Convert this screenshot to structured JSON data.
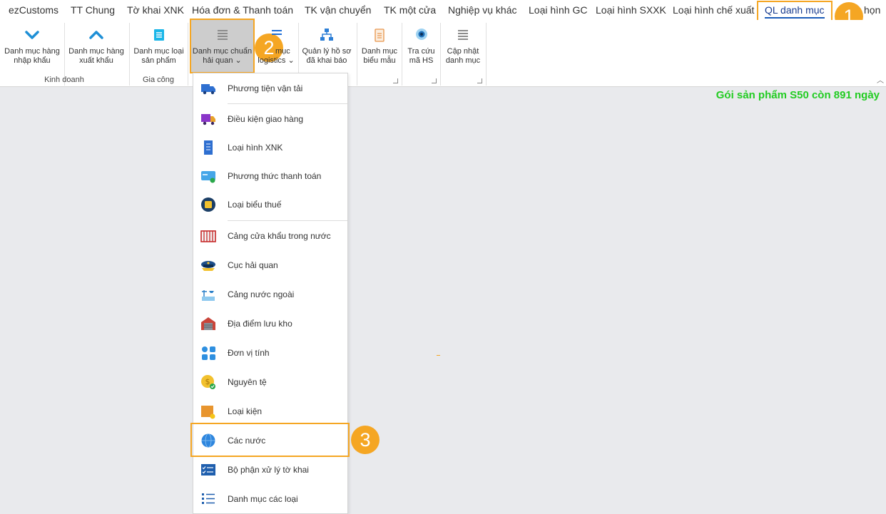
{
  "tabs": [
    {
      "label": "ezCustoms"
    },
    {
      "label": "TT Chung"
    },
    {
      "label": "Tờ khai XNK"
    },
    {
      "label": "Hóa đơn & Thanh toán"
    },
    {
      "label": "TK vận chuyển"
    },
    {
      "label": "TK một cửa"
    },
    {
      "label": "Nghiệp vụ khác"
    },
    {
      "label": "Loại hình GC"
    },
    {
      "label": "Loại hình SXXK"
    },
    {
      "label": "Loại hình chế xuất"
    },
    {
      "label": "QL danh mục"
    },
    {
      "label": "Tùy chọn",
      "visible_fragment": "họn"
    }
  ],
  "active_tab": "QL danh mục",
  "ribbon": {
    "buttons": [
      {
        "line1": "Danh mục hàng",
        "line2": "nhập khẩu",
        "icon": "chevron-down-icon"
      },
      {
        "line1": "Danh mục hàng",
        "line2": "xuất khẩu",
        "icon": "chevron-up-icon"
      },
      {
        "line1": "Danh mục loại",
        "line2": "sản phẩm",
        "icon": "list-icon"
      },
      {
        "line1": "Danh mục chuẩn",
        "line2": "hải quan",
        "icon": "lines-icon",
        "has_dropdown": true,
        "selected": true
      },
      {
        "line1": "Danh mục",
        "line2": "logistics",
        "visible_line1": "mục",
        "icon": "list-icon",
        "has_dropdown": true
      },
      {
        "line1": "Quản lý hồ sơ",
        "line2": "đã khai báo",
        "icon": "sitemap-icon"
      },
      {
        "line1": "Danh mục",
        "line2": "biểu mẫu",
        "icon": "clipboard-icon"
      },
      {
        "line1": "Tra cứu",
        "line2": "mã HS",
        "icon": "eye-icon"
      },
      {
        "line1": "Cập nhật",
        "line2": "danh mục",
        "icon": "lines-icon"
      }
    ],
    "groups": [
      {
        "label": "Kinh doanh"
      },
      {
        "label": "Gia công"
      }
    ]
  },
  "status_text": "Gói sản phẩm S50 còn 891 ngày",
  "dropdown": {
    "items": [
      {
        "label": "Phương tiện vận tải",
        "icon": "truck-icon"
      },
      {
        "label": "Điều kiện giao hàng",
        "icon": "delivery-truck-icon"
      },
      {
        "label": "Loại hình XNK",
        "icon": "document-icon"
      },
      {
        "label": "Phương thức thanh toán",
        "icon": "credit-card-icon"
      },
      {
        "label": "Loại biểu thuế",
        "icon": "tax-icon"
      },
      {
        "label": "Cảng cửa khẩu trong nước",
        "icon": "port-gate-icon"
      },
      {
        "label": "Cục hải quan",
        "icon": "customs-cap-icon"
      },
      {
        "label": "Cảng nước ngoài",
        "icon": "foreign-port-icon"
      },
      {
        "label": "Địa điểm lưu kho",
        "icon": "warehouse-icon"
      },
      {
        "label": "Đơn vị tính",
        "icon": "units-icon"
      },
      {
        "label": "Nguyên tệ",
        "icon": "currency-icon"
      },
      {
        "label": "Loại kiện",
        "icon": "package-icon"
      },
      {
        "label": "Các nước",
        "icon": "globe-icon",
        "highlighted": true
      },
      {
        "label": "Bộ phận xử lý tờ khai",
        "icon": "checklist-icon"
      },
      {
        "label": "Danh mục các loại",
        "icon": "list-icon"
      }
    ]
  },
  "steps": [
    "1",
    "2",
    "3"
  ],
  "colors": {
    "highlight": "#f5a623",
    "status_green": "#22cc22",
    "active_tab_underline": "#1a5bb8"
  }
}
